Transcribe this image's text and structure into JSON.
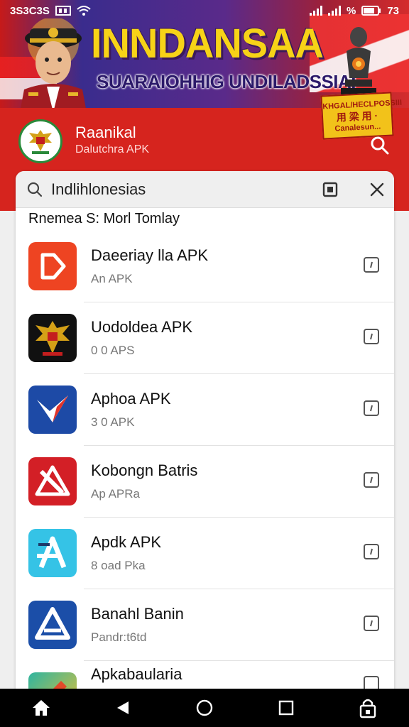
{
  "status_bar": {
    "time": "3S3C3S",
    "battery_percent": "%",
    "battery_value": "73"
  },
  "banner": {
    "title": "INNDANSAA",
    "subtitle": "SUARAIOHHIG UNDILADSSIAI",
    "promo_line1": "KHGAL/HECLPOSSIII",
    "promo_line2": "用 梁 用 ·",
    "promo_line3": "Canalesun..."
  },
  "header": {
    "app_name": "Raanikal",
    "app_sub": "Dalutchra APK"
  },
  "search": {
    "value": "Indlihlonesias"
  },
  "section": {
    "label": "Rnemea S: Morl Tomlay"
  },
  "list": {
    "items": [
      {
        "title": "Daeeriay lla APK",
        "subtitle": "An APK",
        "icon": "document-red-icon",
        "color": "#ee4422"
      },
      {
        "title": "Uodoldea APK",
        "subtitle": "0 0 APS",
        "icon": "garuda-emblem-icon",
        "color": "#111111"
      },
      {
        "title": "Aphoa APK",
        "subtitle": "3 0 APK",
        "icon": "plane-arrow-icon",
        "color": "#1d4aa6"
      },
      {
        "title": "Kobongn Batris",
        "subtitle": "Ap APRa",
        "icon": "warning-pen-icon",
        "color": "#d31f26"
      },
      {
        "title": "Apdk APK",
        "subtitle": "8 oad Pka",
        "icon": "letter-a-icon",
        "color": "#35c3e6"
      },
      {
        "title": "Banahl Banin",
        "subtitle": "Pandr:t6td",
        "icon": "triangle-a-icon",
        "color": "#1b4ea8"
      },
      {
        "title": "Apkabaularia",
        "subtitle": "",
        "icon": "pencil-icon",
        "color": "#2eb5a0"
      }
    ]
  },
  "colors": {
    "header_red": "#d6241e",
    "banner_gold": "#f7d317",
    "nav_black": "#000000"
  },
  "nav": {
    "home": "home-icon",
    "back": "back-icon",
    "home_circle": "circle-home-icon",
    "recent": "recent-apps-icon",
    "lock": "lock-icon"
  }
}
